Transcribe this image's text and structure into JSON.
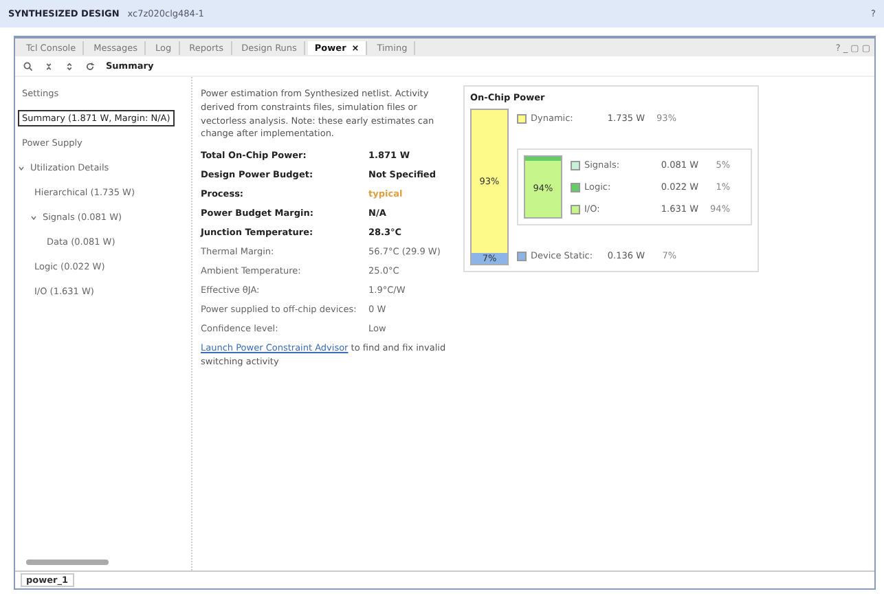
{
  "window": {
    "title": "SYNTHESIZED DESIGN",
    "subtitle": "xc7z020clg484-1",
    "help": "?"
  },
  "tabs": [
    {
      "label": "Tcl Console",
      "selected": false
    },
    {
      "label": "Messages",
      "selected": false
    },
    {
      "label": "Log",
      "selected": false
    },
    {
      "label": "Reports",
      "selected": false
    },
    {
      "label": "Design Runs",
      "selected": false
    },
    {
      "label": "Power",
      "selected": true,
      "close": "×"
    },
    {
      "label": "Timing",
      "selected": false
    }
  ],
  "panel_controls": "? _ ▢ ▢",
  "toolbar": {
    "heading": "Summary"
  },
  "tree": [
    {
      "label": "Settings",
      "selected": false
    },
    {
      "label": "Summary (1.871 W, Margin: N/A)",
      "selected": true
    },
    {
      "label": "Power Supply",
      "selected": false
    },
    {
      "label": "Utilization Details",
      "selected": false,
      "expanded": true,
      "children": [
        {
          "label": "Hierarchical (1.735 W)",
          "selected": false
        },
        {
          "label": "Signals (0.081 W)",
          "selected": false,
          "expanded": true,
          "children": [
            {
              "label": "Data (0.081 W)",
              "selected": false
            }
          ]
        },
        {
          "label": "Logic (0.022 W)",
          "selected": false
        },
        {
          "label": "I/O (1.631 W)",
          "selected": false
        }
      ]
    }
  ],
  "summary": {
    "description": "Power estimation from Synthesized netlist. Activity derived from constraints files, simulation files or vectorless analysis. Note: these early estimates can change after implementation.",
    "rows": [
      {
        "label": "Total On-Chip Power:",
        "value": "1.871 W",
        "bold": true,
        "highlight": false
      },
      {
        "label": "Design Power Budget:",
        "value": "Not Specified",
        "bold": true,
        "highlight": false
      },
      {
        "label": "Process:",
        "value": "typical",
        "bold": true,
        "highlight": true
      },
      {
        "label": "Power Budget Margin:",
        "value": "N/A",
        "bold": true,
        "highlight": false
      },
      {
        "label": "Junction Temperature:",
        "value": "28.3°C",
        "bold": true,
        "highlight": false
      },
      {
        "label": "Thermal Margin:",
        "value": "56.7°C (29.9 W)",
        "bold": false,
        "highlight": false
      },
      {
        "label": "Ambient Temperature:",
        "value": "25.0°C",
        "bold": false,
        "highlight": false
      },
      {
        "label": "Effective θJA:",
        "value": "1.9°C/W",
        "bold": false,
        "highlight": false
      },
      {
        "label": "Power supplied to off-chip devices:",
        "value": "0 W",
        "bold": false,
        "highlight": false
      },
      {
        "label": "Confidence level:",
        "value": "Low",
        "bold": false,
        "highlight": false
      }
    ],
    "link": "Launch Power Constraint Advisor",
    "link_tail": " to find and fix invalid switching activity"
  },
  "on_chip": {
    "title": "On-Chip Power",
    "dynamic": {
      "label": "Dynamic:",
      "value": "1.735 W",
      "percent": "93%",
      "bar_label": "93%",
      "level": 0.93,
      "color": "#fdfa8a"
    },
    "io_bar": {
      "label": "94%",
      "level": 0.94
    },
    "items": [
      {
        "label": "Signals:",
        "value": "0.081 W",
        "percent": "5%",
        "color": "#c8f0d8"
      },
      {
        "label": "Logic:",
        "value": "0.022 W",
        "percent": "1%",
        "color": "#66cc66"
      },
      {
        "label": "I/O:",
        "value": "1.631 W",
        "percent": "94%",
        "color": "#c6f58c"
      }
    ],
    "static": {
      "label": "Device Static:",
      "value": "0.136 W",
      "percent": "7%",
      "bar_label": "7%",
      "color": "#8cb4e6"
    }
  },
  "bottom_tab": {
    "label": "power_1",
    "selected": true
  }
}
